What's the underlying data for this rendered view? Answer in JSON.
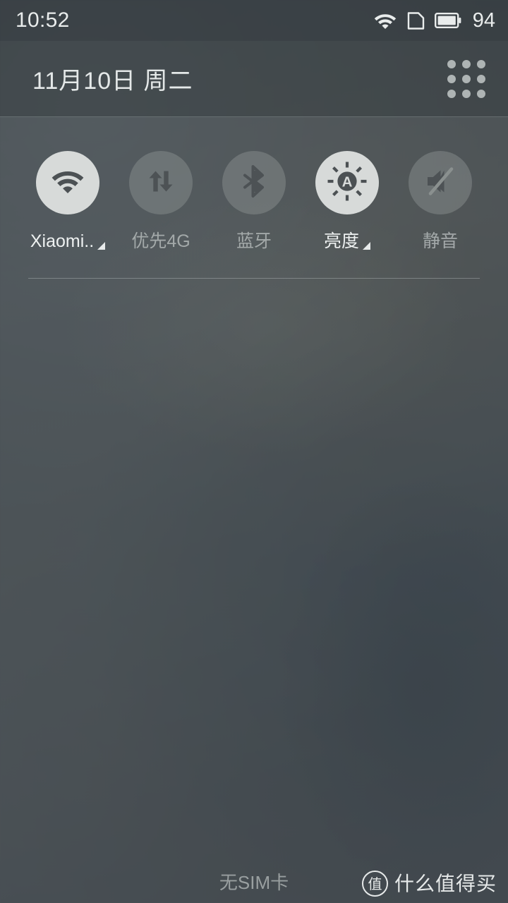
{
  "status_bar": {
    "clock": "10:52",
    "battery_percent": "94",
    "icons": [
      "wifi-icon",
      "sim-card-icon",
      "battery-icon"
    ]
  },
  "header": {
    "date": "11月10日  周二",
    "grid_button": "grid-menu-icon"
  },
  "toggles": [
    {
      "id": "wifi",
      "label": "Xiaomi..",
      "icon": "wifi-icon",
      "active": true,
      "expandable": true
    },
    {
      "id": "mobiledata",
      "label": "优先4G",
      "icon": "mobile-data-icon",
      "active": false,
      "expandable": false
    },
    {
      "id": "bluetooth",
      "label": "蓝牙",
      "icon": "bluetooth-icon",
      "active": false,
      "expandable": false
    },
    {
      "id": "brightness",
      "label": "亮度",
      "icon": "auto-brightness-icon",
      "active": true,
      "expandable": true
    },
    {
      "id": "mute",
      "label": "静音",
      "icon": "volume-mute-icon",
      "active": false,
      "expandable": false
    }
  ],
  "footer": {
    "sim_status": "无SIM卡"
  },
  "watermark": {
    "badge": "值",
    "text": "什么值得买"
  },
  "colors": {
    "panel_bg": "#4b5156",
    "toggle_on_bg": "#d7dad9",
    "toggle_off_bg": "rgba(135,141,141,0.50)",
    "text_primary": "#e9ecec",
    "text_dim": "#aab0b0"
  }
}
